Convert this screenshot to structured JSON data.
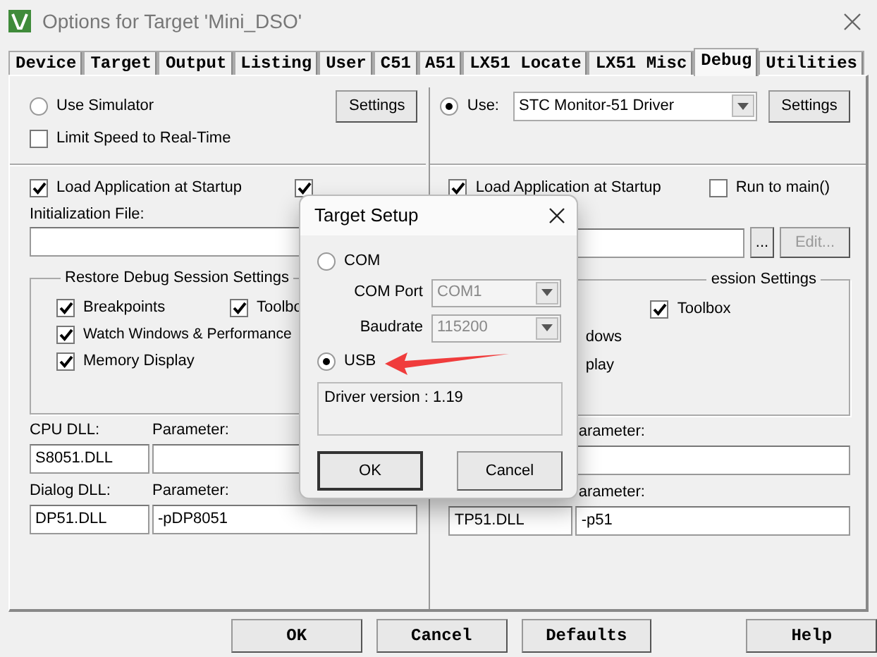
{
  "window": {
    "title": "Options for Target 'Mini_DSO'"
  },
  "tabs": [
    {
      "label": "Device",
      "selected": false
    },
    {
      "label": "Target",
      "selected": false
    },
    {
      "label": "Output",
      "selected": false
    },
    {
      "label": "Listing",
      "selected": false
    },
    {
      "label": "User",
      "selected": false
    },
    {
      "label": "C51",
      "selected": false
    },
    {
      "label": "A51",
      "selected": false
    },
    {
      "label": "LX51 Locate",
      "selected": false
    },
    {
      "label": "LX51 Misc",
      "selected": false
    },
    {
      "label": "Debug",
      "selected": true
    },
    {
      "label": "Utilities",
      "selected": false
    }
  ],
  "left": {
    "mode": {
      "label": "Use Simulator",
      "selected": false
    },
    "settings_button": "Settings",
    "limit_speed": {
      "label": "Limit Speed to Real-Time",
      "checked": false
    },
    "load_app": {
      "label": "Load Application at Startup",
      "checked": true
    },
    "run_to_main": {
      "checked": true
    },
    "init_file_label": "Initialization File:",
    "restore_group": {
      "title": "Restore Debug Session Settings",
      "items": [
        {
          "label": "Breakpoints",
          "checked": true
        },
        {
          "label": "Toolbo",
          "checked": true
        },
        {
          "label": "Watch Windows & Performance",
          "checked": true
        },
        {
          "label": "Memory Display",
          "checked": true
        }
      ]
    },
    "cpu_dll": {
      "label": "CPU DLL:",
      "value": "S8051.DLL"
    },
    "cpu_param": {
      "label": "Parameter:"
    },
    "dialog_dll": {
      "label": "Dialog DLL:",
      "value": "DP51.DLL"
    },
    "dialog_param": {
      "label": "Parameter:",
      "value": "-pDP8051"
    }
  },
  "right": {
    "mode": {
      "label": "Use:",
      "selected": true
    },
    "driver": "STC Monitor-51 Driver",
    "settings_button": "Settings",
    "load_app": {
      "label": "Load Application at Startup",
      "checked": true
    },
    "run_to_main": {
      "label": "Run to main()",
      "checked": false
    },
    "browse_button": "...",
    "edit_button": {
      "label": "Edit...",
      "disabled": true
    },
    "restore_group": {
      "title": "ession Settings",
      "items": [
        {
          "kind": "checkbox",
          "label": "Toolbox",
          "checked": true
        },
        {
          "kind": "fragment",
          "label": "dows"
        },
        {
          "kind": "fragment",
          "label": "play"
        }
      ]
    },
    "driver_param": {
      "label": "arameter:"
    },
    "dialog_dll": {
      "value": "TP51.DLL"
    },
    "dialog_param": {
      "label": "arameter:",
      "value": "-p51"
    }
  },
  "buttons": [
    "OK",
    "Cancel",
    "Defaults",
    "Help"
  ],
  "target_setup": {
    "title": "Target Setup",
    "com": {
      "label": "COM",
      "selected": false
    },
    "com_port": {
      "label": "COM Port",
      "value": "COM1",
      "disabled": true
    },
    "baudrate": {
      "label": "Baudrate",
      "value": "115200",
      "disabled": true
    },
    "usb": {
      "label": "USB",
      "selected": true
    },
    "driver_version": "Driver version : 1.19",
    "buttons": [
      "OK",
      "Cancel"
    ]
  }
}
